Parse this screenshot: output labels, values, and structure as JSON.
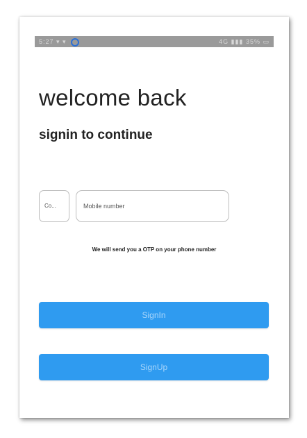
{
  "status_bar": {
    "left_text": "5:27 ▾ ▾",
    "right_text": "4G ▮▮▮ 35% ▭"
  },
  "screen": {
    "title": "welcome back",
    "subtitle": "signin to continue"
  },
  "form": {
    "country_placeholder": "Co...",
    "mobile_placeholder": "Mobile number",
    "otp_note": "We will send you a OTP on your phone number"
  },
  "buttons": {
    "signin_label": "SignIn",
    "signup_label": "SignUp"
  },
  "colors": {
    "accent": "#2f9bf0",
    "button_text": "#a9d6fb",
    "title_text": "#222222"
  }
}
